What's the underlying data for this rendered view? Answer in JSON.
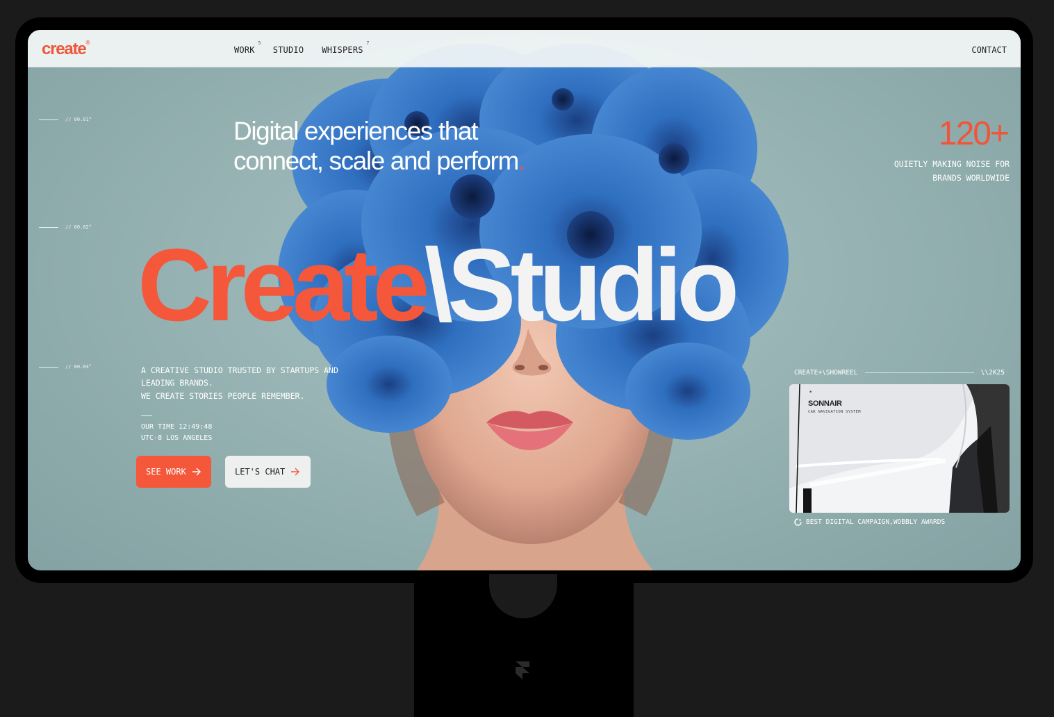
{
  "nav": {
    "logo": "create",
    "logo_mark": "®",
    "links": [
      {
        "label": "WORK",
        "count": "5"
      },
      {
        "label": "STUDIO",
        "count": ""
      },
      {
        "label": "WHISPERS",
        "count": "7"
      }
    ],
    "contact": "CONTACT"
  },
  "markers": [
    "// 00.01°",
    "// 00.02°",
    "// 00.03°"
  ],
  "hero": {
    "headline_line1": "Digital experiences that",
    "headline_line2": "connect, scale and perform",
    "headline_dot": ".",
    "title_create": "Create",
    "title_slash": "\\",
    "title_studio": "Studio"
  },
  "stat": {
    "number": "120+",
    "caption_line1": "QUIETLY MAKING NOISE FOR",
    "caption_line2": "BRANDS WORLDWIDE"
  },
  "intro": {
    "line1": "A CREATIVE STUDIO TRUSTED BY STARTUPS AND LEADING BRANDS.",
    "line2": "WE CREATE STORIES PEOPLE REMEMBER.",
    "time_line1": "OUR TIME 12:49:48",
    "time_line2": "UTC-8 LOS ANGELES"
  },
  "buttons": {
    "see_work": "SEE WORK",
    "lets_chat": "LET'S CHAT"
  },
  "showreel": {
    "label": "CREATE+\\SHOWREEL",
    "year": "\\\\2K25",
    "card_brand": "SONNAIR",
    "card_sub": "CAR NAVIGATION SYSTEM",
    "award": "BEST DIGITAL CAMPAIGN,WOBBLY AWARDS"
  },
  "colors": {
    "accent": "#f5573b",
    "background": "#97b3b4",
    "flower": "#2f6db8"
  }
}
